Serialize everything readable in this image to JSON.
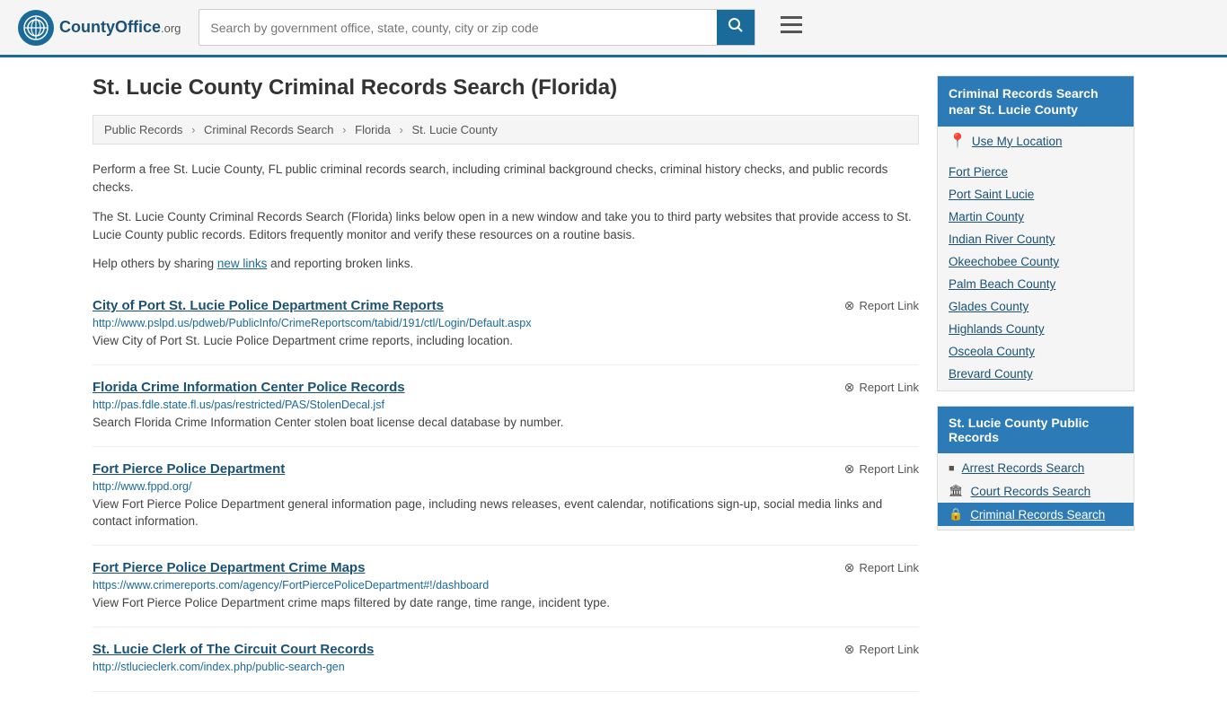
{
  "header": {
    "logo_icon": "★",
    "logo_name": "CountyOffice",
    "logo_suffix": ".org",
    "search_placeholder": "Search by government office, state, county, city or zip code",
    "search_button_icon": "🔍"
  },
  "page": {
    "title": "St. Lucie County Criminal Records Search (Florida)",
    "breadcrumbs": [
      {
        "label": "Public Records",
        "href": "#"
      },
      {
        "label": "Criminal Records Search",
        "href": "#"
      },
      {
        "label": "Florida",
        "href": "#"
      },
      {
        "label": "St. Lucie County",
        "href": "#"
      }
    ],
    "description1": "Perform a free St. Lucie County, FL public criminal records search, including criminal background checks, criminal history checks, and public records checks.",
    "description2": "The St. Lucie County Criminal Records Search (Florida) links below open in a new window and take you to third party websites that provide access to St. Lucie County public records. Editors frequently monitor and verify these resources on a routine basis.",
    "description3_prefix": "Help others by sharing ",
    "new_links_text": "new links",
    "description3_suffix": " and reporting broken links."
  },
  "results": [
    {
      "title": "City of Port St. Lucie Police Department Crime Reports",
      "url": "http://www.pslpd.us/pdweb/PublicInfo/CrimeReportscom/tabid/191/ctl/Login/Default.aspx",
      "description": "View City of Port St. Lucie Police Department crime reports, including location.",
      "report_label": "Report Link"
    },
    {
      "title": "Florida Crime Information Center Police Records",
      "url": "http://pas.fdle.state.fl.us/pas/restricted/PAS/StolenDecal.jsf",
      "description": "Search Florida Crime Information Center stolen boat license decal database by number.",
      "report_label": "Report Link"
    },
    {
      "title": "Fort Pierce Police Department",
      "url": "http://www.fppd.org/",
      "description": "View Fort Pierce Police Department general information page, including news releases, event calendar, notifications sign-up, social media links and contact information.",
      "report_label": "Report Link"
    },
    {
      "title": "Fort Pierce Police Department Crime Maps",
      "url": "https://www.crimereports.com/agency/FortPiercePoliceDepartment#!/dashboard",
      "description": "View Fort Pierce Police Department crime maps filtered by date range, time range, incident type.",
      "report_label": "Report Link"
    },
    {
      "title": "St. Lucie Clerk of The Circuit Court Records",
      "url": "http://stlucieclerk.com/index.php/public-search-gen",
      "description": "",
      "report_label": "Report Link"
    }
  ],
  "sidebar": {
    "nearby_header": "Criminal Records Search near St. Lucie County",
    "use_location_label": "Use My Location",
    "nearby_links": [
      "Fort Pierce",
      "Port Saint Lucie",
      "Martin County",
      "Indian River County",
      "Okeechobee County",
      "Palm Beach County",
      "Glades County",
      "Highlands County",
      "Osceola County",
      "Brevard County"
    ],
    "public_records_header": "St. Lucie County Public Records",
    "public_records_links": [
      {
        "label": "Arrest Records Search",
        "icon": "■",
        "active": false
      },
      {
        "label": "Court Records Search",
        "icon": "🏛",
        "active": false
      },
      {
        "label": "Criminal Records Search",
        "icon": "🔒",
        "active": true
      }
    ]
  }
}
